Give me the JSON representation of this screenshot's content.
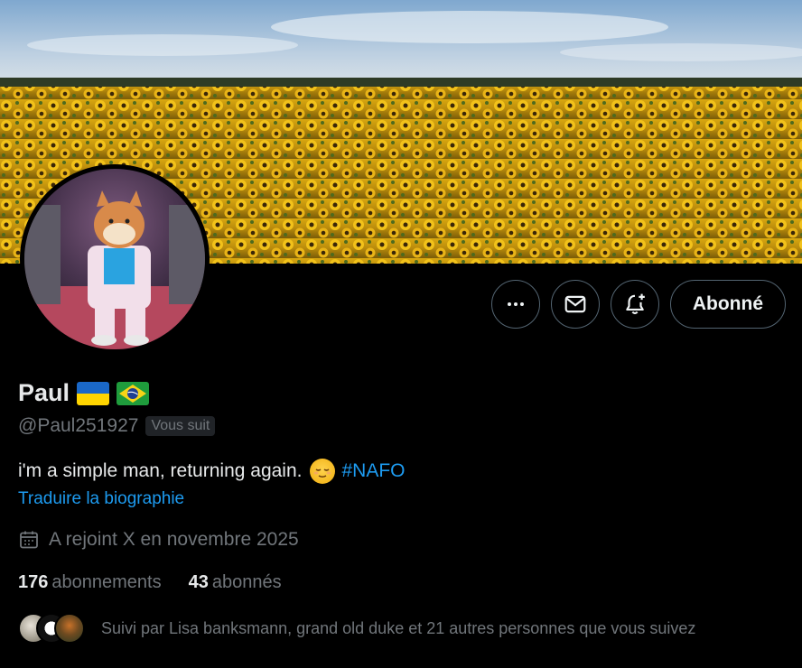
{
  "profile": {
    "display_name": "Paul",
    "handle": "@Paul251927",
    "follows_you_badge": "Vous suit",
    "bio_text": "i'm a simple man, returning again.",
    "bio_hashtag": "#NAFO",
    "translate_link": "Traduire la biographie",
    "joined": "A rejoint X en novembre 2025",
    "following_count": "176",
    "following_label": "abonnements",
    "followers_count": "43",
    "followers_label": "abonnés",
    "followed_by": "Suivi par Lisa banksmann, grand old duke et 21 autres personnes que vous suivez"
  },
  "actions": {
    "follow_state_label": "Abonné"
  },
  "icons": {
    "more": "more-horizontal-icon",
    "message": "envelope-icon",
    "notify": "bell-plus-icon",
    "calendar": "calendar-icon"
  },
  "colors": {
    "background": "#000000",
    "primary_text": "#e7e9ea",
    "secondary_text": "#71767b",
    "link": "#1d9bf0",
    "border": "#536471"
  }
}
